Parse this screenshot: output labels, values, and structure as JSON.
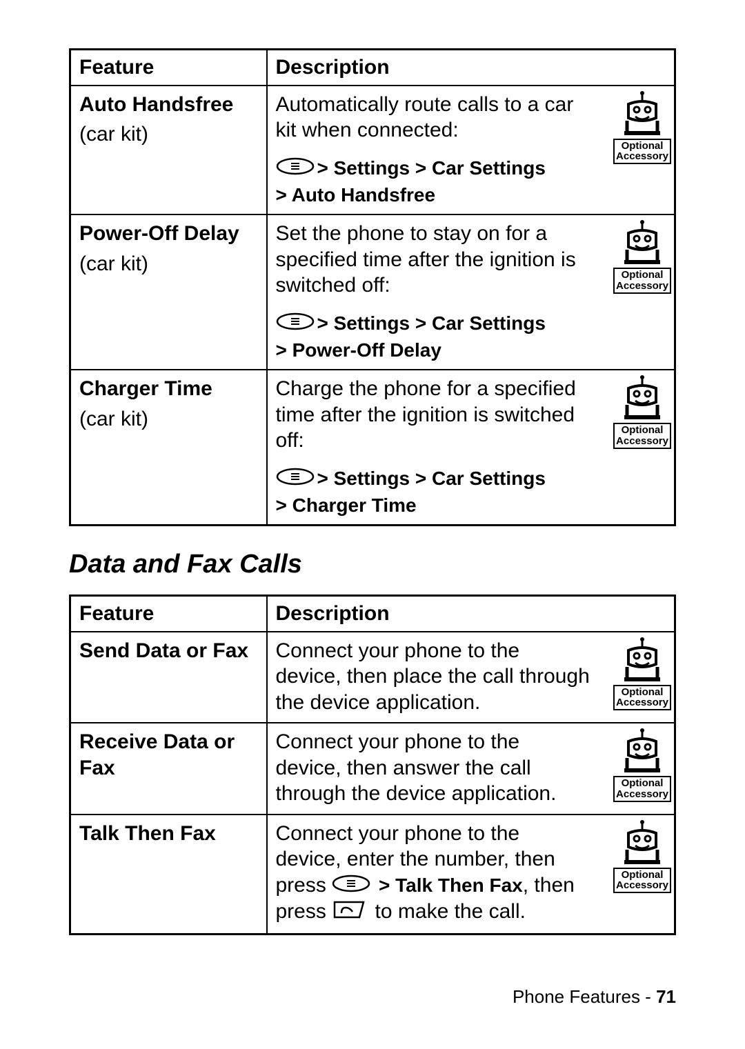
{
  "table1": {
    "headers": {
      "feature": "Feature",
      "description": "Description"
    },
    "rows": [
      {
        "feature_title": "Auto Handsfree",
        "feature_sub": "(car kit)",
        "desc": "Automatically route calls to a car kit when connected:",
        "nav1": " > Settings > Car Settings",
        "nav2": "> Auto Handsfree",
        "badge1": "Optional",
        "badge2": "Accessory"
      },
      {
        "feature_title": "Power-Off Delay",
        "feature_sub": "(car kit)",
        "desc": "Set the phone to stay on for a specified time after the ignition is switched off:",
        "nav1": " > Settings > Car Settings",
        "nav2": "> Power-Off Delay",
        "badge1": "Optional",
        "badge2": "Accessory"
      },
      {
        "feature_title": "Charger Time",
        "feature_sub": "(car kit)",
        "desc": "Charge the phone for a specified time after the ignition is switched off:",
        "nav1": " > Settings > Car Settings",
        "nav2": "> Charger Time",
        "badge1": "Optional",
        "badge2": "Accessory"
      }
    ]
  },
  "section_heading": "Data and Fax Calls",
  "table2": {
    "headers": {
      "feature": "Feature",
      "description": "Description"
    },
    "rows": [
      {
        "feature_title": "Send Data or Fax",
        "feature_sub": "",
        "desc": "Connect your phone to the device, then place the call through the device application.",
        "badge1": "Optional",
        "badge2": "Accessory"
      },
      {
        "feature_title": "Receive Data or Fax",
        "feature_sub": "",
        "desc": "Connect your phone to the device, then answer the call through the device application.",
        "badge1": "Optional",
        "badge2": "Accessory"
      },
      {
        "feature_title": "Talk Then Fax",
        "feature_sub": "",
        "desc_pre": "Connect your phone to the device, enter the number, then press",
        "nav_inline": " > Talk Then Fax",
        "desc_mid": ", then press",
        "desc_post": " to make the call.",
        "badge1": "Optional",
        "badge2": "Accessory"
      }
    ]
  },
  "footer": {
    "label": "Phone Features - ",
    "page": "71"
  }
}
